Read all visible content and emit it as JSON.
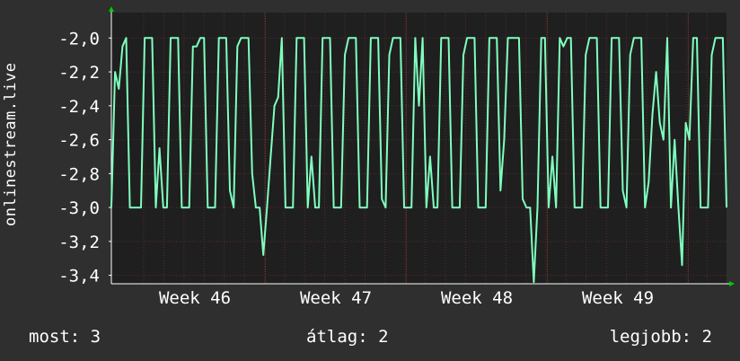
{
  "chart_data": {
    "type": "line",
    "title": "",
    "xlabel": "",
    "ylabel": "onlinestream.live",
    "ylim": [
      -3.45,
      -1.85
    ],
    "y_ticks": [
      -2.0,
      -2.2,
      -2.4,
      -2.6,
      -2.8,
      -3.0,
      -3.2,
      -3.4
    ],
    "y_tick_labels": [
      "-2,0",
      "-2,2",
      "-2,4",
      "-2,6",
      "-2,8",
      "-3,0",
      "-3,2",
      "-3,4"
    ],
    "x_ticks": [
      "Week 46",
      "Week 47",
      "Week 48",
      "Week 49"
    ],
    "grid": true,
    "series": [
      {
        "color": "#7fffbf",
        "points": [
          [
            0,
            -3.0
          ],
          [
            1,
            -2.2
          ],
          [
            2,
            -2.3
          ],
          [
            3,
            -2.05
          ],
          [
            4,
            -2.0
          ],
          [
            5,
            -3.0
          ],
          [
            6,
            -3.0
          ],
          [
            7,
            -3.0
          ],
          [
            8,
            -3.0
          ],
          [
            9,
            -2.0
          ],
          [
            10,
            -2.0
          ],
          [
            11,
            -2.0
          ],
          [
            12,
            -3.0
          ],
          [
            13,
            -2.65
          ],
          [
            14,
            -3.0
          ],
          [
            15,
            -3.0
          ],
          [
            16,
            -2.0
          ],
          [
            17,
            -2.0
          ],
          [
            18,
            -2.0
          ],
          [
            19,
            -3.0
          ],
          [
            20,
            -3.0
          ],
          [
            21,
            -3.0
          ],
          [
            22,
            -2.05
          ],
          [
            23,
            -2.05
          ],
          [
            24,
            -2.0
          ],
          [
            25,
            -2.0
          ],
          [
            26,
            -3.0
          ],
          [
            27,
            -3.0
          ],
          [
            28,
            -3.0
          ],
          [
            29,
            -2.0
          ],
          [
            30,
            -2.0
          ],
          [
            31,
            -2.0
          ],
          [
            32,
            -2.9
          ],
          [
            33,
            -3.0
          ],
          [
            34,
            -2.05
          ],
          [
            35,
            -2.0
          ],
          [
            36,
            -2.0
          ],
          [
            37,
            -2.0
          ],
          [
            38,
            -2.8
          ],
          [
            39,
            -3.0
          ],
          [
            40,
            -3.0
          ],
          [
            41,
            -3.28
          ],
          [
            42,
            -3.0
          ],
          [
            43,
            -2.7
          ],
          [
            44,
            -2.4
          ],
          [
            45,
            -2.35
          ],
          [
            46,
            -2.0
          ],
          [
            47,
            -3.0
          ],
          [
            48,
            -3.0
          ],
          [
            49,
            -3.0
          ],
          [
            50,
            -2.0
          ],
          [
            51,
            -2.0
          ],
          [
            52,
            -2.0
          ],
          [
            53,
            -3.0
          ],
          [
            54,
            -2.7
          ],
          [
            55,
            -3.0
          ],
          [
            56,
            -3.0
          ],
          [
            57,
            -2.0
          ],
          [
            58,
            -2.0
          ],
          [
            59,
            -2.0
          ],
          [
            60,
            -3.0
          ],
          [
            61,
            -3.0
          ],
          [
            62,
            -3.0
          ],
          [
            63,
            -2.1
          ],
          [
            64,
            -2.0
          ],
          [
            65,
            -2.0
          ],
          [
            66,
            -2.0
          ],
          [
            67,
            -3.0
          ],
          [
            68,
            -3.0
          ],
          [
            69,
            -3.0
          ],
          [
            70,
            -2.0
          ],
          [
            71,
            -2.0
          ],
          [
            72,
            -2.0
          ],
          [
            73,
            -2.95
          ],
          [
            74,
            -3.0
          ],
          [
            75,
            -2.1
          ],
          [
            76,
            -2.0
          ],
          [
            77,
            -2.0
          ],
          [
            78,
            -2.0
          ],
          [
            79,
            -3.0
          ],
          [
            80,
            -3.0
          ],
          [
            81,
            -3.0
          ],
          [
            82,
            -2.0
          ],
          [
            83,
            -2.4
          ],
          [
            84,
            -2.0
          ],
          [
            85,
            -3.0
          ],
          [
            86,
            -2.7
          ],
          [
            87,
            -3.0
          ],
          [
            88,
            -3.0
          ],
          [
            89,
            -2.0
          ],
          [
            90,
            -2.0
          ],
          [
            91,
            -2.0
          ],
          [
            92,
            -3.0
          ],
          [
            93,
            -3.0
          ],
          [
            94,
            -3.0
          ],
          [
            95,
            -2.1
          ],
          [
            96,
            -2.0
          ],
          [
            97,
            -2.0
          ],
          [
            98,
            -2.0
          ],
          [
            99,
            -3.0
          ],
          [
            100,
            -3.0
          ],
          [
            101,
            -3.0
          ],
          [
            102,
            -2.0
          ],
          [
            103,
            -2.0
          ],
          [
            104,
            -2.0
          ],
          [
            105,
            -2.9
          ],
          [
            106,
            -2.6
          ],
          [
            107,
            -2.0
          ],
          [
            108,
            -2.0
          ],
          [
            109,
            -2.0
          ],
          [
            110,
            -2.0
          ],
          [
            111,
            -2.95
          ],
          [
            112,
            -3.0
          ],
          [
            113,
            -3.0
          ],
          [
            114,
            -3.44
          ],
          [
            115,
            -3.0
          ],
          [
            116,
            -2.0
          ],
          [
            117,
            -2.0
          ],
          [
            118,
            -3.0
          ],
          [
            119,
            -2.7
          ],
          [
            120,
            -3.0
          ],
          [
            121,
            -2.0
          ],
          [
            122,
            -2.05
          ],
          [
            123,
            -2.0
          ],
          [
            124,
            -2.0
          ],
          [
            125,
            -3.0
          ],
          [
            126,
            -3.0
          ],
          [
            127,
            -3.0
          ],
          [
            128,
            -2.1
          ],
          [
            129,
            -2.0
          ],
          [
            130,
            -2.0
          ],
          [
            131,
            -2.0
          ],
          [
            132,
            -3.0
          ],
          [
            133,
            -3.0
          ],
          [
            134,
            -3.0
          ],
          [
            135,
            -2.0
          ],
          [
            136,
            -2.0
          ],
          [
            137,
            -2.0
          ],
          [
            138,
            -2.9
          ],
          [
            139,
            -3.0
          ],
          [
            140,
            -2.1
          ],
          [
            141,
            -2.0
          ],
          [
            142,
            -2.0
          ],
          [
            143,
            -2.0
          ],
          [
            144,
            -3.0
          ],
          [
            145,
            -2.85
          ],
          [
            146,
            -2.45
          ],
          [
            147,
            -2.2
          ],
          [
            148,
            -2.5
          ],
          [
            149,
            -2.6
          ],
          [
            150,
            -2.0
          ],
          [
            151,
            -3.0
          ],
          [
            152,
            -2.6
          ],
          [
            153,
            -3.0
          ],
          [
            154,
            -3.34
          ],
          [
            155,
            -2.5
          ],
          [
            156,
            -2.6
          ],
          [
            157,
            -2.0
          ],
          [
            158,
            -2.0
          ],
          [
            159,
            -3.0
          ],
          [
            160,
            -3.0
          ],
          [
            161,
            -3.0
          ],
          [
            162,
            -2.1
          ],
          [
            163,
            -2.0
          ],
          [
            164,
            -2.0
          ],
          [
            165,
            -2.0
          ],
          [
            166,
            -3.0
          ]
        ]
      }
    ]
  },
  "stats": {
    "now": "most: 3",
    "average": "átlag: 2",
    "best": "legjobb: 2"
  },
  "colors": {
    "background": "#2f2f2f",
    "plot_background": "#1f1f1f",
    "grid": "#5a2b2b",
    "line": "#7fffbf",
    "axis": "#ffffff",
    "arrow": "#00cc00",
    "text": "#ffffff"
  }
}
